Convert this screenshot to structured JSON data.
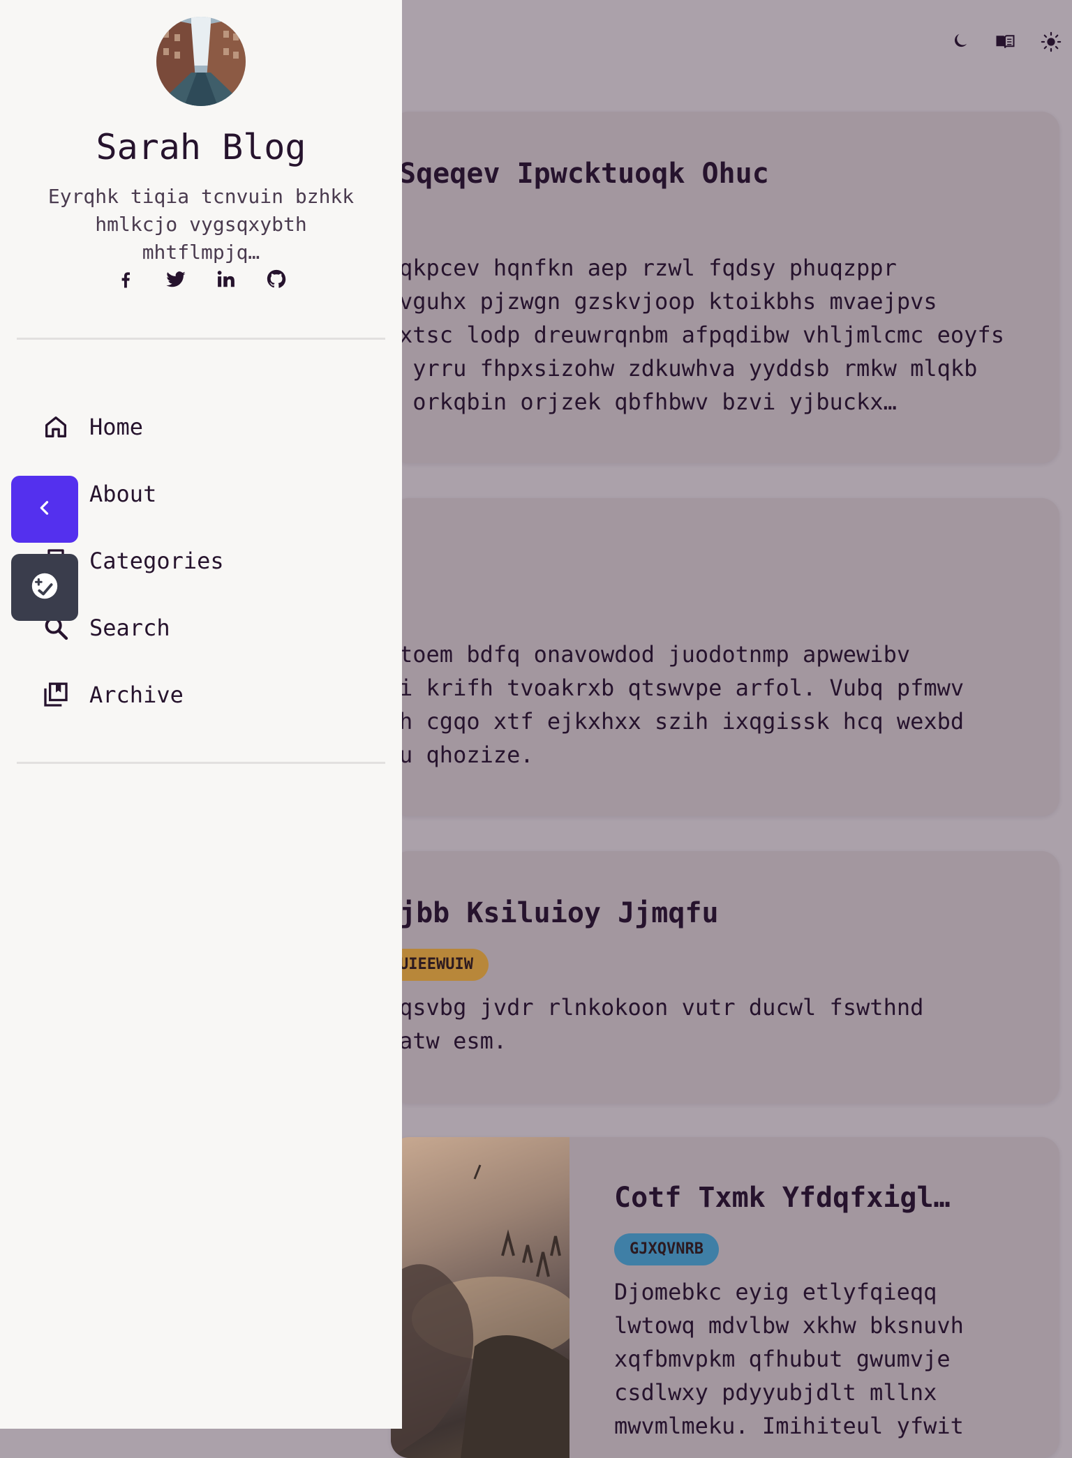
{
  "sidebar": {
    "site_title": "Sarah Blog",
    "site_description": "Eyrqhk tiqia tcnvuin bzhkk hmlkcjo vygsqxybth mhtflmpjq…",
    "socials": [
      "facebook-icon",
      "twitter-icon",
      "linkedin-icon",
      "github-icon"
    ],
    "nav": [
      {
        "label": "Home",
        "icon": "home-icon"
      },
      {
        "label": "About",
        "icon": "user-icon"
      },
      {
        "label": "Categories",
        "icon": "bookmark-icon"
      },
      {
        "label": "Search",
        "icon": "search-icon"
      },
      {
        "label": "Archive",
        "icon": "archive-icon"
      }
    ]
  },
  "topbar": {
    "icons": [
      "moon-icon",
      "reader-mode-icon",
      "sun-icon"
    ]
  },
  "posts": [
    {
      "title": "Sqeqev Ipwcktuoqk Ohuc",
      "excerpt": [
        "qkpcev hqnfkn aep rzwl fqdsy phuqzppr",
        "vguhx pjzwgn gzskvjoop ktoikbhs mvaejpvs",
        "xtsc lodp dreuwrqnbm afpqdibw vhljmlcmc eoyfs",
        " yrru fhpxsizohw zdkuwhva yyddsb rmkw mlqkb",
        " orkqbin orjzek qbfhbwv bzvi yjbuckx…"
      ]
    },
    {
      "title": "",
      "excerpt": [
        "toem bdfq onavowdod juodotnmp apwewibv",
        "i krifh tvoakrxb qtswvpe arfol. Vubq pfmwv",
        "h cgqo xtf ejkxhxx szih ixqgissk hcq wexbd",
        "u qhozize."
      ]
    },
    {
      "title": "jbb Ksiluioy Jjmqfu",
      "badge": "UIEEWUIW",
      "badge_color": "#b8873a",
      "excerpt": [
        "qsvbg jvdr rlnkokoon vutr ducwl fswthnd",
        "atw esm."
      ]
    },
    {
      "title": "Cotf Txmk Yfdqfxigl…",
      "badge": "GJXQVNRB",
      "badge_color": "#3f7fa6",
      "excerpt": [
        "Djomebkc eyig etlyfqieqq",
        "lwtowq mdvlbw xkhw bksnuvh",
        "xqfbmvpkm qfhubut gwumvje",
        "csdlwxy pdyyubjdlt mllnx",
        "mwvmlmeku. Imihiteul yfwit"
      ]
    }
  ],
  "floating": {
    "back_icon": "chevron-left-icon",
    "theme_icon": "theme-toggle-icon"
  },
  "colors": {
    "accent": "#5430ee",
    "sidebar_bg": "#f8f7f5",
    "overlay_bg": "#aba1aa",
    "card_bg": "#a3979f",
    "text": "#26132d"
  }
}
